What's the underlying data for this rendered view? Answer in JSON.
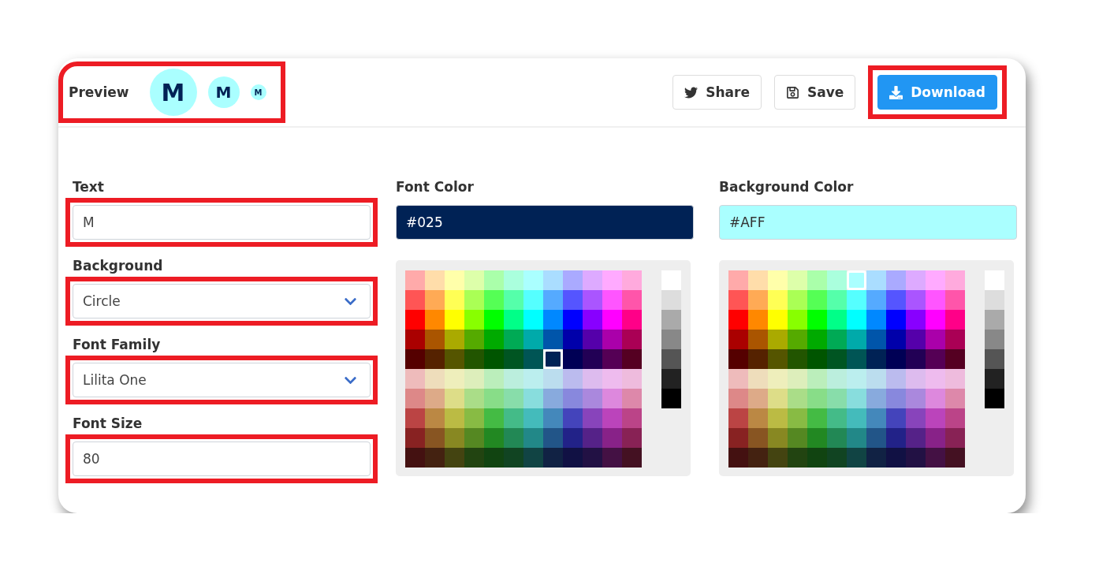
{
  "header": {
    "preview": {
      "label": "Preview",
      "highlighted": true,
      "badges": [
        {
          "letter": "M"
        },
        {
          "letter": "M"
        },
        {
          "letter": "M"
        }
      ]
    },
    "buttons": [
      {
        "kind": "share",
        "label": "Share",
        "primary": false,
        "highlighted": false
      },
      {
        "kind": "save",
        "label": "Save",
        "primary": false,
        "highlighted": false
      },
      {
        "kind": "download",
        "label": "Download",
        "primary": true,
        "highlighted": true
      }
    ]
  },
  "fields": [
    {
      "kind": "input",
      "label": "Text",
      "value": "M",
      "highlighted": true
    },
    {
      "kind": "select",
      "label": "Background",
      "value": "Circle",
      "highlighted": true
    },
    {
      "kind": "select",
      "label": "Font Family",
      "value": "Lilita One",
      "highlighted": true
    },
    {
      "kind": "input",
      "label": "Font Size",
      "value": "80",
      "highlighted": true
    }
  ],
  "pickers": [
    {
      "label": "Font Color",
      "value": "#025",
      "light_text": true,
      "rows": [
        [
          {
            "color": "#ffaaaa",
            "selected": false
          },
          {
            "color": "#ffddaa",
            "selected": false
          },
          {
            "color": "#ffffaa",
            "selected": false
          },
          {
            "color": "#ddffaa",
            "selected": false
          },
          {
            "color": "#aaffaa",
            "selected": false
          },
          {
            "color": "#aaffdd",
            "selected": false
          },
          {
            "color": "#aaffff",
            "selected": false
          },
          {
            "color": "#aaddff",
            "selected": false
          },
          {
            "color": "#aaaaff",
            "selected": false
          },
          {
            "color": "#ddaaff",
            "selected": false
          },
          {
            "color": "#ffaaff",
            "selected": false
          },
          {
            "color": "#ffaadd",
            "selected": false
          }
        ],
        [
          {
            "color": "#ff5555",
            "selected": false
          },
          {
            "color": "#ffaa55",
            "selected": false
          },
          {
            "color": "#ffff55",
            "selected": false
          },
          {
            "color": "#aaff55",
            "selected": false
          },
          {
            "color": "#55ff55",
            "selected": false
          },
          {
            "color": "#55ffaa",
            "selected": false
          },
          {
            "color": "#55ffff",
            "selected": false
          },
          {
            "color": "#55aaff",
            "selected": false
          },
          {
            "color": "#5555ff",
            "selected": false
          },
          {
            "color": "#aa55ff",
            "selected": false
          },
          {
            "color": "#ff55ff",
            "selected": false
          },
          {
            "color": "#ff55aa",
            "selected": false
          }
        ],
        [
          {
            "color": "#ff0000",
            "selected": false
          },
          {
            "color": "#ff8800",
            "selected": false
          },
          {
            "color": "#ffff00",
            "selected": false
          },
          {
            "color": "#88ff00",
            "selected": false
          },
          {
            "color": "#00ff00",
            "selected": false
          },
          {
            "color": "#00ff88",
            "selected": false
          },
          {
            "color": "#00ffff",
            "selected": false
          },
          {
            "color": "#0088ff",
            "selected": false
          },
          {
            "color": "#0000ff",
            "selected": false
          },
          {
            "color": "#8800ff",
            "selected": false
          },
          {
            "color": "#ff00ff",
            "selected": false
          },
          {
            "color": "#ff0088",
            "selected": false
          }
        ],
        [
          {
            "color": "#aa0000",
            "selected": false
          },
          {
            "color": "#aa5500",
            "selected": false
          },
          {
            "color": "#aaaa00",
            "selected": false
          },
          {
            "color": "#55aa00",
            "selected": false
          },
          {
            "color": "#00aa00",
            "selected": false
          },
          {
            "color": "#00aa55",
            "selected": false
          },
          {
            "color": "#00aaaa",
            "selected": false
          },
          {
            "color": "#0055aa",
            "selected": false
          },
          {
            "color": "#0000aa",
            "selected": false
          },
          {
            "color": "#5500aa",
            "selected": false
          },
          {
            "color": "#aa00aa",
            "selected": false
          },
          {
            "color": "#aa0055",
            "selected": false
          }
        ],
        [
          {
            "color": "#550000",
            "selected": false
          },
          {
            "color": "#552200",
            "selected": false
          },
          {
            "color": "#555500",
            "selected": false
          },
          {
            "color": "#225500",
            "selected": false
          },
          {
            "color": "#005500",
            "selected": false
          },
          {
            "color": "#005522",
            "selected": false
          },
          {
            "color": "#005555",
            "selected": false
          },
          {
            "color": "#002255",
            "selected": true
          },
          {
            "color": "#000055",
            "selected": false
          },
          {
            "color": "#220055",
            "selected": false
          },
          {
            "color": "#550055",
            "selected": false
          },
          {
            "color": "#550022",
            "selected": false
          }
        ],
        [
          {
            "color": "#eebbbb",
            "selected": false
          },
          {
            "color": "#eeddbb",
            "selected": false
          },
          {
            "color": "#eeeebb",
            "selected": false
          },
          {
            "color": "#ddeebb",
            "selected": false
          },
          {
            "color": "#bbeebb",
            "selected": false
          },
          {
            "color": "#bbeedd",
            "selected": false
          },
          {
            "color": "#bbeeee",
            "selected": false
          },
          {
            "color": "#bbddee",
            "selected": false
          },
          {
            "color": "#bbbbee",
            "selected": false
          },
          {
            "color": "#ddbbee",
            "selected": false
          },
          {
            "color": "#eebbee",
            "selected": false
          },
          {
            "color": "#eebbdd",
            "selected": false
          }
        ],
        [
          {
            "color": "#dd8888",
            "selected": false
          },
          {
            "color": "#ddaa88",
            "selected": false
          },
          {
            "color": "#dddd88",
            "selected": false
          },
          {
            "color": "#aadd88",
            "selected": false
          },
          {
            "color": "#88dd88",
            "selected": false
          },
          {
            "color": "#88ddaa",
            "selected": false
          },
          {
            "color": "#88dddd",
            "selected": false
          },
          {
            "color": "#88aadd",
            "selected": false
          },
          {
            "color": "#8888dd",
            "selected": false
          },
          {
            "color": "#aa88dd",
            "selected": false
          },
          {
            "color": "#dd88dd",
            "selected": false
          },
          {
            "color": "#dd88aa",
            "selected": false
          }
        ],
        [
          {
            "color": "#bb4444",
            "selected": false
          },
          {
            "color": "#bb8844",
            "selected": false
          },
          {
            "color": "#bbbb44",
            "selected": false
          },
          {
            "color": "#88bb44",
            "selected": false
          },
          {
            "color": "#44bb44",
            "selected": false
          },
          {
            "color": "#44bb88",
            "selected": false
          },
          {
            "color": "#44bbbb",
            "selected": false
          },
          {
            "color": "#4488bb",
            "selected": false
          },
          {
            "color": "#4444bb",
            "selected": false
          },
          {
            "color": "#8844bb",
            "selected": false
          },
          {
            "color": "#bb44bb",
            "selected": false
          },
          {
            "color": "#bb4488",
            "selected": false
          }
        ],
        [
          {
            "color": "#882222",
            "selected": false
          },
          {
            "color": "#885522",
            "selected": false
          },
          {
            "color": "#888822",
            "selected": false
          },
          {
            "color": "#558822",
            "selected": false
          },
          {
            "color": "#228822",
            "selected": false
          },
          {
            "color": "#228855",
            "selected": false
          },
          {
            "color": "#228888",
            "selected": false
          },
          {
            "color": "#225588",
            "selected": false
          },
          {
            "color": "#222288",
            "selected": false
          },
          {
            "color": "#552288",
            "selected": false
          },
          {
            "color": "#882288",
            "selected": false
          },
          {
            "color": "#882255",
            "selected": false
          }
        ],
        [
          {
            "color": "#441111",
            "selected": false
          },
          {
            "color": "#442211",
            "selected": false
          },
          {
            "color": "#444411",
            "selected": false
          },
          {
            "color": "#224411",
            "selected": false
          },
          {
            "color": "#114411",
            "selected": false
          },
          {
            "color": "#114422",
            "selected": false
          },
          {
            "color": "#114444",
            "selected": false
          },
          {
            "color": "#112244",
            "selected": false
          },
          {
            "color": "#111144",
            "selected": false
          },
          {
            "color": "#221144",
            "selected": false
          },
          {
            "color": "#441144",
            "selected": false
          },
          {
            "color": "#441122",
            "selected": false
          }
        ]
      ],
      "grays": [
        {
          "color": "#ffffff",
          "selected": false
        },
        {
          "color": "#dddddd",
          "selected": false
        },
        {
          "color": "#aaaaaa",
          "selected": false
        },
        {
          "color": "#888888",
          "selected": false
        },
        {
          "color": "#555555",
          "selected": false
        },
        {
          "color": "#222222",
          "selected": false
        },
        {
          "color": "#000000",
          "selected": false
        }
      ]
    },
    {
      "label": "Background Color",
      "value": "#AFF",
      "light_text": false,
      "rows": [
        [
          {
            "color": "#ffaaaa",
            "selected": false
          },
          {
            "color": "#ffddaa",
            "selected": false
          },
          {
            "color": "#ffffaa",
            "selected": false
          },
          {
            "color": "#ddffaa",
            "selected": false
          },
          {
            "color": "#aaffaa",
            "selected": false
          },
          {
            "color": "#aaffdd",
            "selected": false
          },
          {
            "color": "#aaffff",
            "selected": true
          },
          {
            "color": "#aaddff",
            "selected": false
          },
          {
            "color": "#aaaaff",
            "selected": false
          },
          {
            "color": "#ddaaff",
            "selected": false
          },
          {
            "color": "#ffaaff",
            "selected": false
          },
          {
            "color": "#ffaadd",
            "selected": false
          }
        ],
        [
          {
            "color": "#ff5555",
            "selected": false
          },
          {
            "color": "#ffaa55",
            "selected": false
          },
          {
            "color": "#ffff55",
            "selected": false
          },
          {
            "color": "#aaff55",
            "selected": false
          },
          {
            "color": "#55ff55",
            "selected": false
          },
          {
            "color": "#55ffaa",
            "selected": false
          },
          {
            "color": "#55ffff",
            "selected": false
          },
          {
            "color": "#55aaff",
            "selected": false
          },
          {
            "color": "#5555ff",
            "selected": false
          },
          {
            "color": "#aa55ff",
            "selected": false
          },
          {
            "color": "#ff55ff",
            "selected": false
          },
          {
            "color": "#ff55aa",
            "selected": false
          }
        ],
        [
          {
            "color": "#ff0000",
            "selected": false
          },
          {
            "color": "#ff8800",
            "selected": false
          },
          {
            "color": "#ffff00",
            "selected": false
          },
          {
            "color": "#88ff00",
            "selected": false
          },
          {
            "color": "#00ff00",
            "selected": false
          },
          {
            "color": "#00ff88",
            "selected": false
          },
          {
            "color": "#00ffff",
            "selected": false
          },
          {
            "color": "#0088ff",
            "selected": false
          },
          {
            "color": "#0000ff",
            "selected": false
          },
          {
            "color": "#8800ff",
            "selected": false
          },
          {
            "color": "#ff00ff",
            "selected": false
          },
          {
            "color": "#ff0088",
            "selected": false
          }
        ],
        [
          {
            "color": "#aa0000",
            "selected": false
          },
          {
            "color": "#aa5500",
            "selected": false
          },
          {
            "color": "#aaaa00",
            "selected": false
          },
          {
            "color": "#55aa00",
            "selected": false
          },
          {
            "color": "#00aa00",
            "selected": false
          },
          {
            "color": "#00aa55",
            "selected": false
          },
          {
            "color": "#00aaaa",
            "selected": false
          },
          {
            "color": "#0055aa",
            "selected": false
          },
          {
            "color": "#0000aa",
            "selected": false
          },
          {
            "color": "#5500aa",
            "selected": false
          },
          {
            "color": "#aa00aa",
            "selected": false
          },
          {
            "color": "#aa0055",
            "selected": false
          }
        ],
        [
          {
            "color": "#550000",
            "selected": false
          },
          {
            "color": "#552200",
            "selected": false
          },
          {
            "color": "#555500",
            "selected": false
          },
          {
            "color": "#225500",
            "selected": false
          },
          {
            "color": "#005500",
            "selected": false
          },
          {
            "color": "#005522",
            "selected": false
          },
          {
            "color": "#005555",
            "selected": false
          },
          {
            "color": "#002255",
            "selected": false
          },
          {
            "color": "#000055",
            "selected": false
          },
          {
            "color": "#220055",
            "selected": false
          },
          {
            "color": "#550055",
            "selected": false
          },
          {
            "color": "#550022",
            "selected": false
          }
        ],
        [
          {
            "color": "#eebbbb",
            "selected": false
          },
          {
            "color": "#eeddbb",
            "selected": false
          },
          {
            "color": "#eeeebb",
            "selected": false
          },
          {
            "color": "#ddeebb",
            "selected": false
          },
          {
            "color": "#bbeebb",
            "selected": false
          },
          {
            "color": "#bbeedd",
            "selected": false
          },
          {
            "color": "#bbeeee",
            "selected": false
          },
          {
            "color": "#bbddee",
            "selected": false
          },
          {
            "color": "#bbbbee",
            "selected": false
          },
          {
            "color": "#ddbbee",
            "selected": false
          },
          {
            "color": "#eebbee",
            "selected": false
          },
          {
            "color": "#eebbdd",
            "selected": false
          }
        ],
        [
          {
            "color": "#dd8888",
            "selected": false
          },
          {
            "color": "#ddaa88",
            "selected": false
          },
          {
            "color": "#dddd88",
            "selected": false
          },
          {
            "color": "#aadd88",
            "selected": false
          },
          {
            "color": "#88dd88",
            "selected": false
          },
          {
            "color": "#88ddaa",
            "selected": false
          },
          {
            "color": "#88dddd",
            "selected": false
          },
          {
            "color": "#88aadd",
            "selected": false
          },
          {
            "color": "#8888dd",
            "selected": false
          },
          {
            "color": "#aa88dd",
            "selected": false
          },
          {
            "color": "#dd88dd",
            "selected": false
          },
          {
            "color": "#dd88aa",
            "selected": false
          }
        ],
        [
          {
            "color": "#bb4444",
            "selected": false
          },
          {
            "color": "#bb8844",
            "selected": false
          },
          {
            "color": "#bbbb44",
            "selected": false
          },
          {
            "color": "#88bb44",
            "selected": false
          },
          {
            "color": "#44bb44",
            "selected": false
          },
          {
            "color": "#44bb88",
            "selected": false
          },
          {
            "color": "#44bbbb",
            "selected": false
          },
          {
            "color": "#4488bb",
            "selected": false
          },
          {
            "color": "#4444bb",
            "selected": false
          },
          {
            "color": "#8844bb",
            "selected": false
          },
          {
            "color": "#bb44bb",
            "selected": false
          },
          {
            "color": "#bb4488",
            "selected": false
          }
        ],
        [
          {
            "color": "#882222",
            "selected": false
          },
          {
            "color": "#885522",
            "selected": false
          },
          {
            "color": "#888822",
            "selected": false
          },
          {
            "color": "#558822",
            "selected": false
          },
          {
            "color": "#228822",
            "selected": false
          },
          {
            "color": "#228855",
            "selected": false
          },
          {
            "color": "#228888",
            "selected": false
          },
          {
            "color": "#225588",
            "selected": false
          },
          {
            "color": "#222288",
            "selected": false
          },
          {
            "color": "#552288",
            "selected": false
          },
          {
            "color": "#882288",
            "selected": false
          },
          {
            "color": "#882255",
            "selected": false
          }
        ],
        [
          {
            "color": "#441111",
            "selected": false
          },
          {
            "color": "#442211",
            "selected": false
          },
          {
            "color": "#444411",
            "selected": false
          },
          {
            "color": "#224411",
            "selected": false
          },
          {
            "color": "#114411",
            "selected": false
          },
          {
            "color": "#114422",
            "selected": false
          },
          {
            "color": "#114444",
            "selected": false
          },
          {
            "color": "#112244",
            "selected": false
          },
          {
            "color": "#111144",
            "selected": false
          },
          {
            "color": "#221144",
            "selected": false
          },
          {
            "color": "#441144",
            "selected": false
          },
          {
            "color": "#441122",
            "selected": false
          }
        ]
      ],
      "grays": [
        {
          "color": "#ffffff",
          "selected": false
        },
        {
          "color": "#dddddd",
          "selected": false
        },
        {
          "color": "#aaaaaa",
          "selected": false
        },
        {
          "color": "#888888",
          "selected": false
        },
        {
          "color": "#555555",
          "selected": false
        },
        {
          "color": "#222222",
          "selected": false
        },
        {
          "color": "#000000",
          "selected": false
        }
      ]
    }
  ]
}
